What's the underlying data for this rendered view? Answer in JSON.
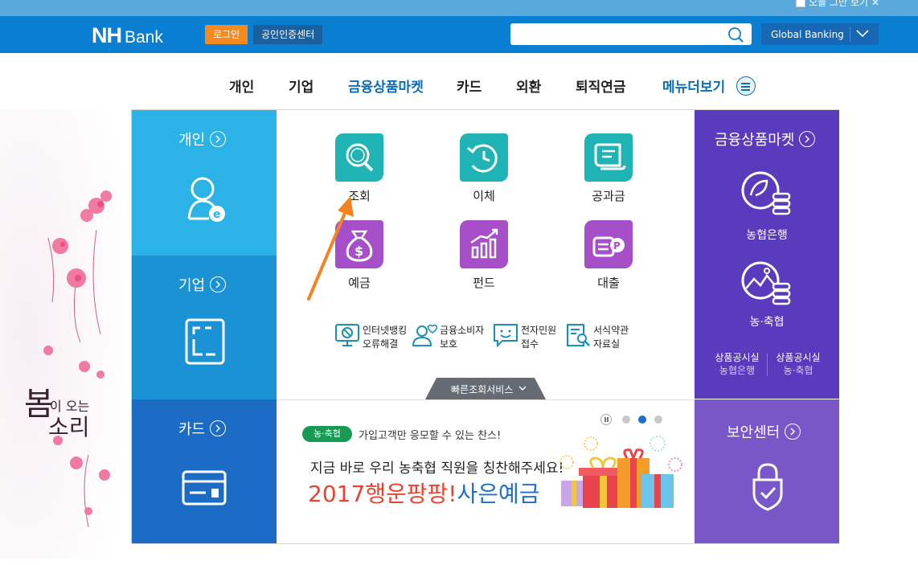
{
  "top": {
    "no_show_today": "오늘 그만 보기"
  },
  "header": {
    "logo_nh": "NH",
    "logo_bank": "Bank",
    "login_label": "로그인",
    "cert_label": "공인인증센터",
    "search_placeholder": "",
    "global_label": "Global Banking"
  },
  "gnb": {
    "items": [
      "개인",
      "기업",
      "금융상품마켓",
      "카드",
      "외환",
      "퇴직연금"
    ],
    "more_label": "메뉴더보기"
  },
  "deco_text": "봄이 오는 소리",
  "left_panels": [
    {
      "title": "개인",
      "icon": "personal-user-icon",
      "color": "#2bb3e8"
    },
    {
      "title": "기업",
      "icon": "corporate-frame-icon",
      "color": "#1a92d4"
    },
    {
      "title": "카드",
      "icon": "card-icon",
      "color": "#1c6cc6"
    }
  ],
  "center": {
    "tiles": [
      {
        "label": "조회",
        "icon": "search-icon",
        "color": "#1fb3b5"
      },
      {
        "label": "이체",
        "icon": "clock-transfer-icon",
        "color": "#1fb3b5"
      },
      {
        "label": "공과금",
        "icon": "receipt-icon",
        "color": "#1fb3b5"
      },
      {
        "label": "예금",
        "icon": "money-bag-icon",
        "color": "#a64fc9"
      },
      {
        "label": "펀드",
        "icon": "bar-chart-icon",
        "color": "#a64fc9"
      },
      {
        "label": "대출",
        "icon": "coin-loan-icon",
        "color": "#a64fc9"
      }
    ],
    "quick_links": [
      {
        "line1": "인터넷뱅킹",
        "line2": "오류해결",
        "icon": "monitor-block-icon"
      },
      {
        "line1": "금융소비자",
        "line2": "보호",
        "icon": "consumer-heart-icon"
      },
      {
        "line1": "전자민원",
        "line2": "접수",
        "icon": "chat-smile-icon"
      },
      {
        "line1": "서식약관",
        "line2": "자료실",
        "icon": "document-search-icon"
      }
    ],
    "quick_service_label": "빠른조회서비스"
  },
  "banner": {
    "badge": "농·축협",
    "subtitle": "가입고객만 응모할 수 있는 찬스!",
    "line1": "지금 바로 우리 농축협 직원을 칭찬해주세요!",
    "headline_red": "2017행운팡팡!",
    "headline_blue": "사은예금",
    "active_dot": 2
  },
  "right_top": {
    "title": "금융상품마켓",
    "items": [
      {
        "label": "농협은행",
        "icon": "nh-bank-coins-icon"
      },
      {
        "label": "농·축협",
        "icon": "nh-coop-coins-icon"
      }
    ],
    "notices": [
      {
        "line1": "상품공시실",
        "line2": "농협은행"
      },
      {
        "line1": "상품공시실",
        "line2": "농·축협"
      }
    ],
    "color": "#5b3bbd"
  },
  "right_bottom": {
    "title": "보안센터",
    "icon": "security-shield-icon",
    "color": "#7a57c9"
  }
}
